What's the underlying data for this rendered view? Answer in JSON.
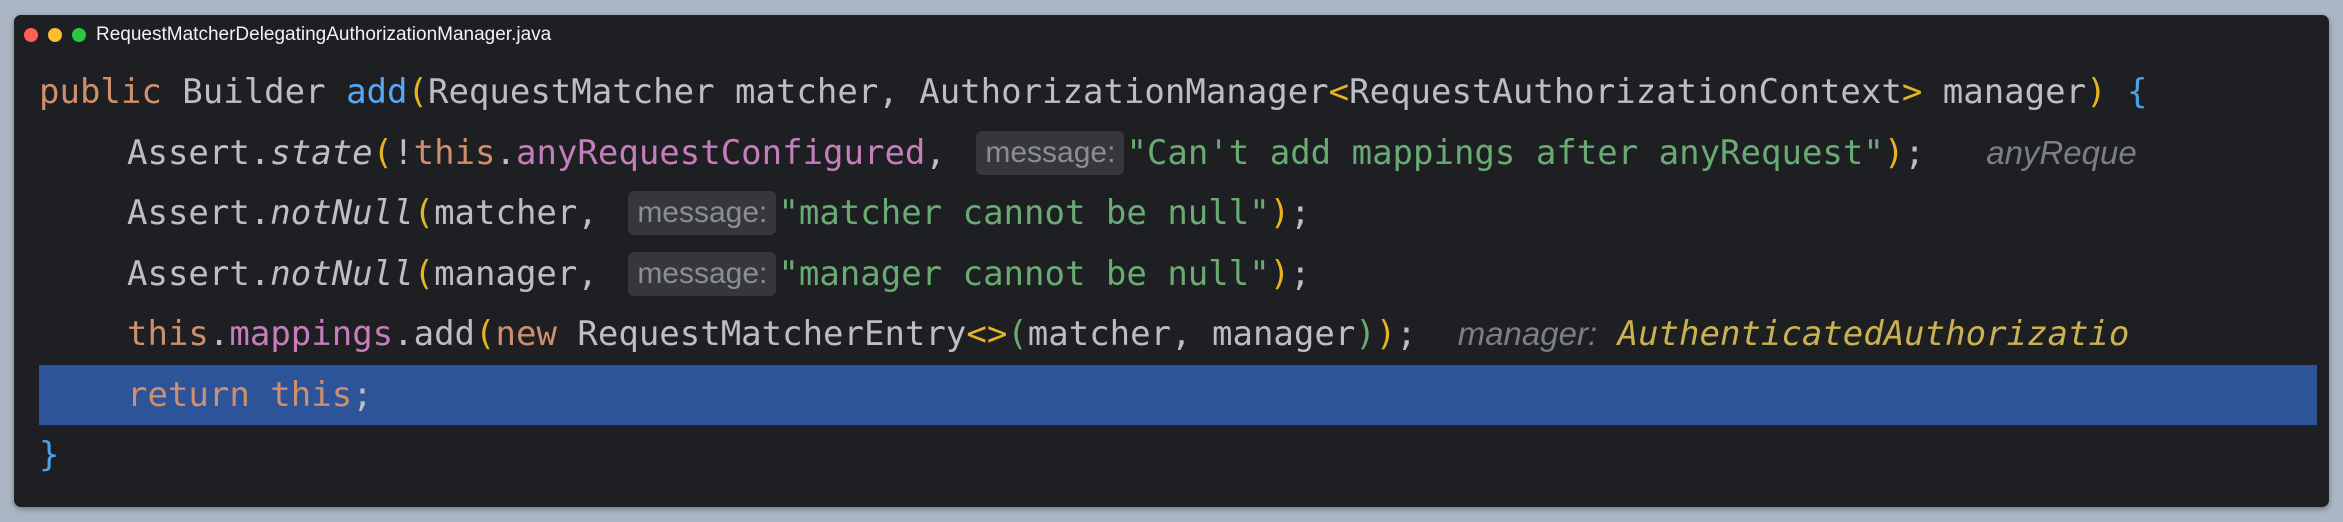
{
  "window": {
    "title": "RequestMatcherDelegatingAuthorizationManager.java"
  },
  "colors": {
    "background": "#abb6c4",
    "editor_bg": "#1e1f22",
    "keyword": "#cf8e6d",
    "method": "#56a8f5",
    "field": "#c77dbb",
    "string": "#6aab73",
    "selection": "#2d5499"
  },
  "code": {
    "l1": {
      "kw_public": "public",
      "type_builder": " Builder ",
      "fn_add": "add",
      "paren_open": "(",
      "params_a": "RequestMatcher matcher, AuthorizationManager",
      "lt": "<",
      "generic": "RequestAuthorizationContext",
      "gt": ">",
      "params_b": " manager",
      "paren_close": ")",
      "space": " ",
      "brace_open": "{"
    },
    "l2": {
      "assert": "Assert.",
      "method": "state",
      "paren_open": "(",
      "bang": "!",
      "kw_this": "this",
      "dot": ".",
      "field": "anyRequestConfigured",
      "comma": ", ",
      "hint": "message:",
      "string": "\"Can't add mappings after anyRequest\"",
      "paren_close": ")",
      "semi": ";",
      "inlay": "anyReque"
    },
    "l3": {
      "assert": "Assert.",
      "method": "notNull",
      "paren_open": "(",
      "arg": "matcher, ",
      "hint": "message:",
      "string": "\"matcher cannot be null\"",
      "paren_close": ")",
      "semi": ";"
    },
    "l4": {
      "assert": "Assert.",
      "method": "notNull",
      "paren_open": "(",
      "arg": "manager, ",
      "hint": "message:",
      "string": "\"manager cannot be null\"",
      "paren_close": ")",
      "semi": ";"
    },
    "l5": {
      "kw_this": "this",
      "dot": ".",
      "field": "mappings",
      "add": ".add",
      "paren_open": "(",
      "kw_new": "new",
      "cls": " RequestMatcherEntry",
      "diamond": "<>",
      "paren_open2": "(",
      "args": "matcher, manager",
      "paren_close2": ")",
      "paren_close": ")",
      "semi": ";",
      "inlay_label": "manager:",
      "inlay_value": "AuthenticatedAuthorizatio"
    },
    "l6": {
      "kw_return": "return",
      "kw_this": " this",
      "semi": ";"
    },
    "l7": {
      "brace_close": "}"
    }
  }
}
